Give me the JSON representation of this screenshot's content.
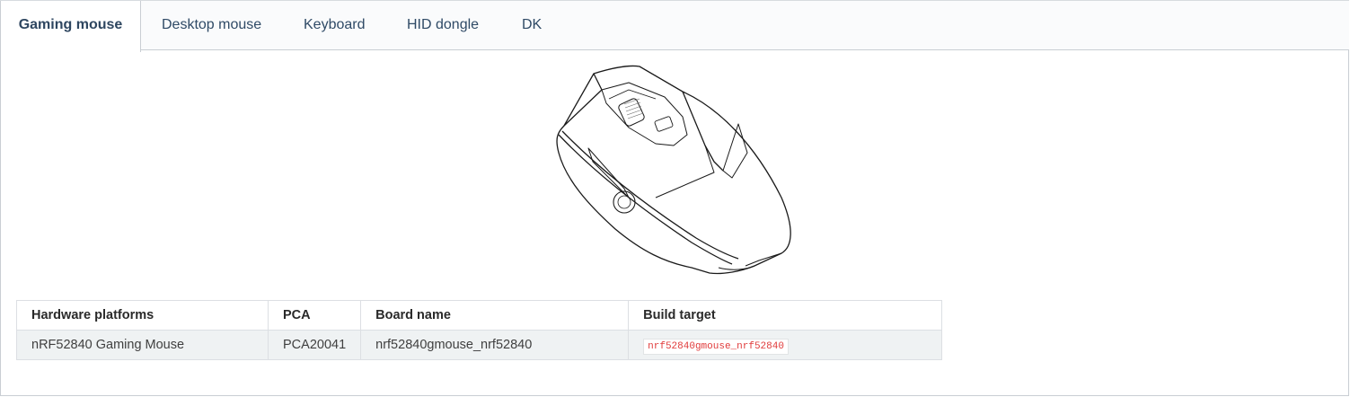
{
  "tabs": [
    {
      "label": "Gaming mouse",
      "active": true
    },
    {
      "label": "Desktop mouse",
      "active": false
    },
    {
      "label": "Keyboard",
      "active": false
    },
    {
      "label": "HID dongle",
      "active": false
    },
    {
      "label": "DK",
      "active": false
    }
  ],
  "figure": {
    "icon": "gaming-mouse-illustration"
  },
  "table": {
    "headers": [
      "Hardware platforms",
      "PCA",
      "Board name",
      "Build target"
    ],
    "rows": [
      [
        "nRF52840 Gaming Mouse",
        "PCA20041",
        "nrf52840gmouse_nrf52840",
        "nrf52840gmouse_nrf52840"
      ]
    ]
  },
  "colors": {
    "accent": "#2e4660",
    "code": "#e03b3b",
    "row_bg": "#eff2f3"
  }
}
